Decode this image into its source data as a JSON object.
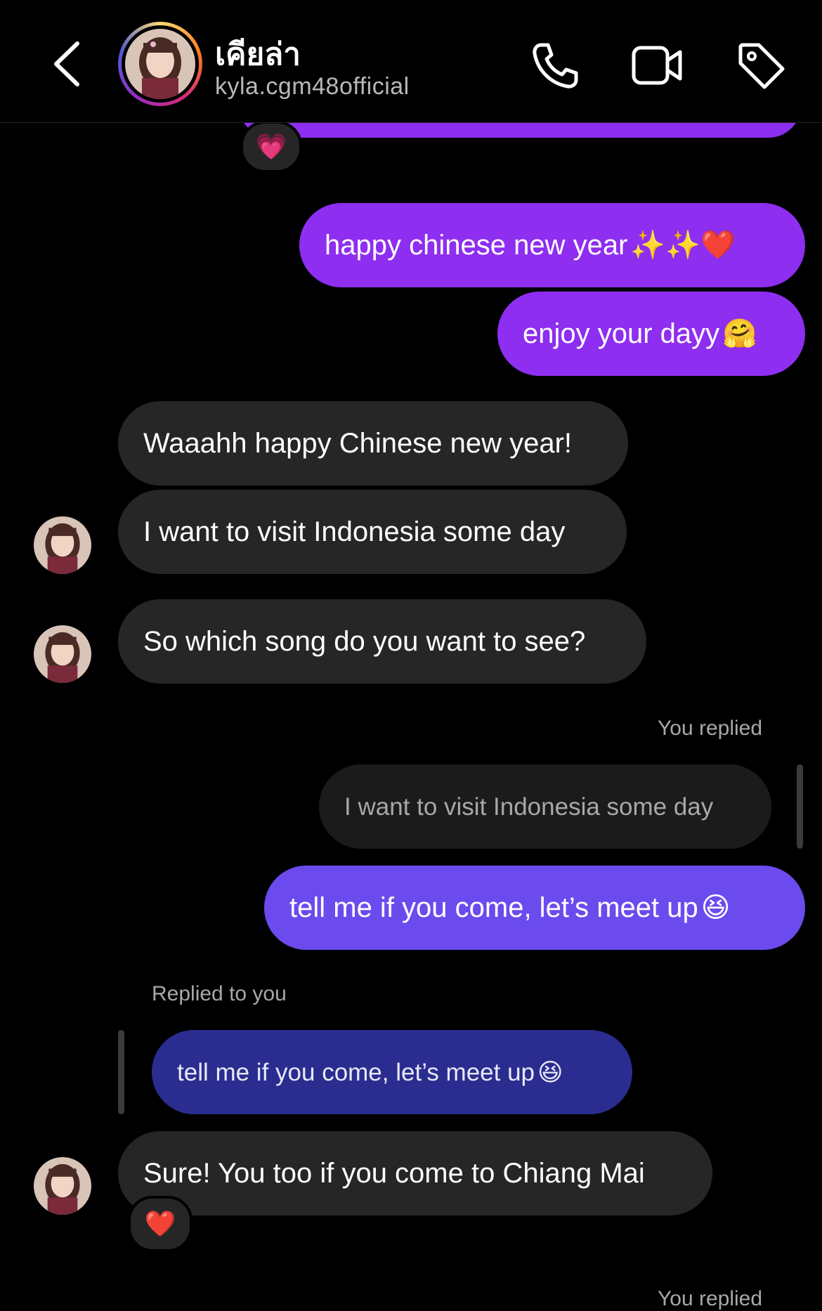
{
  "header": {
    "name": "เคียล่า",
    "username": "kyla.cgm48official",
    "icons": [
      "back-arrow-icon",
      "phone-icon",
      "video-camera-icon",
      "tag-icon"
    ]
  },
  "top_reaction": "💗",
  "messages": [
    {
      "id": "m1",
      "side": "out",
      "text": "happy chinese new year",
      "emoji": "✨✨❤️"
    },
    {
      "id": "m2",
      "side": "out",
      "text": "enjoy your dayy",
      "emoji": "🤗"
    },
    {
      "id": "m3",
      "side": "in",
      "text": "Waaahh happy Chinese new year!"
    },
    {
      "id": "m4",
      "side": "in",
      "text": "I want to visit Indonesia some day"
    },
    {
      "id": "m5",
      "side": "in",
      "text": "So which song do you want to see?"
    },
    {
      "id": "m6",
      "side": "out",
      "reply_label": "You replied",
      "quoted": "I want to visit Indonesia some day",
      "text": "tell me if you come, let’s meet up",
      "emoji": "😆"
    },
    {
      "id": "m7",
      "side": "in",
      "reply_label": "Replied to you",
      "quoted": "tell me if you come, let’s meet up",
      "quoted_emoji": "😆",
      "text": "Sure! You too if you come to Chiang Mai",
      "reaction": "❤️"
    }
  ],
  "bottom_meta": "You replied",
  "colors": {
    "outgoing": "#8e2ef0",
    "outgoing_latest": "#6b4bee",
    "incoming": "#262626",
    "quoted_outgoing": "#2a2d8f"
  }
}
